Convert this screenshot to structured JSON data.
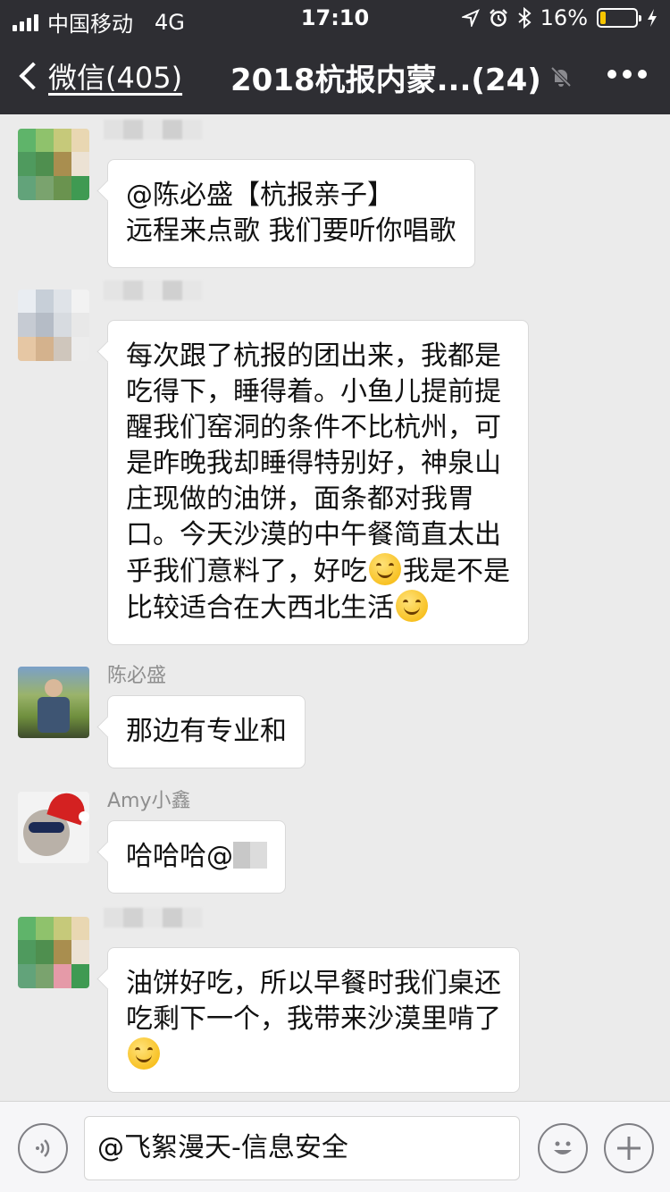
{
  "status_bar": {
    "carrier": "中国移动",
    "network": "4G",
    "time": "17:10",
    "battery_percent_text": "16%",
    "battery_level": 0.16
  },
  "nav": {
    "back_label": "微信(405)",
    "title": "2018杭报内蒙...(24)"
  },
  "messages": [
    {
      "sender": "",
      "lines": [
        "@陈必盛【杭报亲子】",
        "远程来点歌 我们要听你唱歌"
      ]
    },
    {
      "sender": "",
      "lines": [
        "每次跟了杭报的团出来，我都是",
        "吃得下，睡得着。小鱼儿提前提",
        "醒我们窑洞的条件不比杭州，可",
        "是昨晚我却睡得特别好，神泉山",
        "庄现做的油饼，面条都对我胃",
        "口。今天沙漠的中午餐简直太出",
        "乎我们意料了，好吃",
        "比较适合在大西北生活"
      ],
      "inline_after_line7": "我是不是"
    },
    {
      "sender": "陈必盛",
      "lines": [
        "那边有专业和"
      ]
    },
    {
      "sender": "Amy小鑫",
      "lines": [
        "哈哈哈@"
      ]
    },
    {
      "sender": "",
      "lines": [
        "油饼好吃，所以早餐时我们桌还",
        "吃剩下一个，我带来沙漠里啃了"
      ]
    }
  ],
  "input": {
    "value": "@飞絮漫天-信息安全"
  },
  "colors": {
    "nav_bg": "#2e2e33",
    "chat_bg": "#ebebeb",
    "bubble_bg": "#ffffff",
    "battery_fill": "#f5c400"
  },
  "icons": [
    "signal-icon",
    "location-arrow-icon",
    "alarm-icon",
    "bluetooth-icon",
    "battery-icon",
    "charging-icon",
    "back-chevron-icon",
    "mute-bell-icon",
    "more-icon",
    "voice-icon",
    "emoji-icon",
    "plus-icon"
  ]
}
